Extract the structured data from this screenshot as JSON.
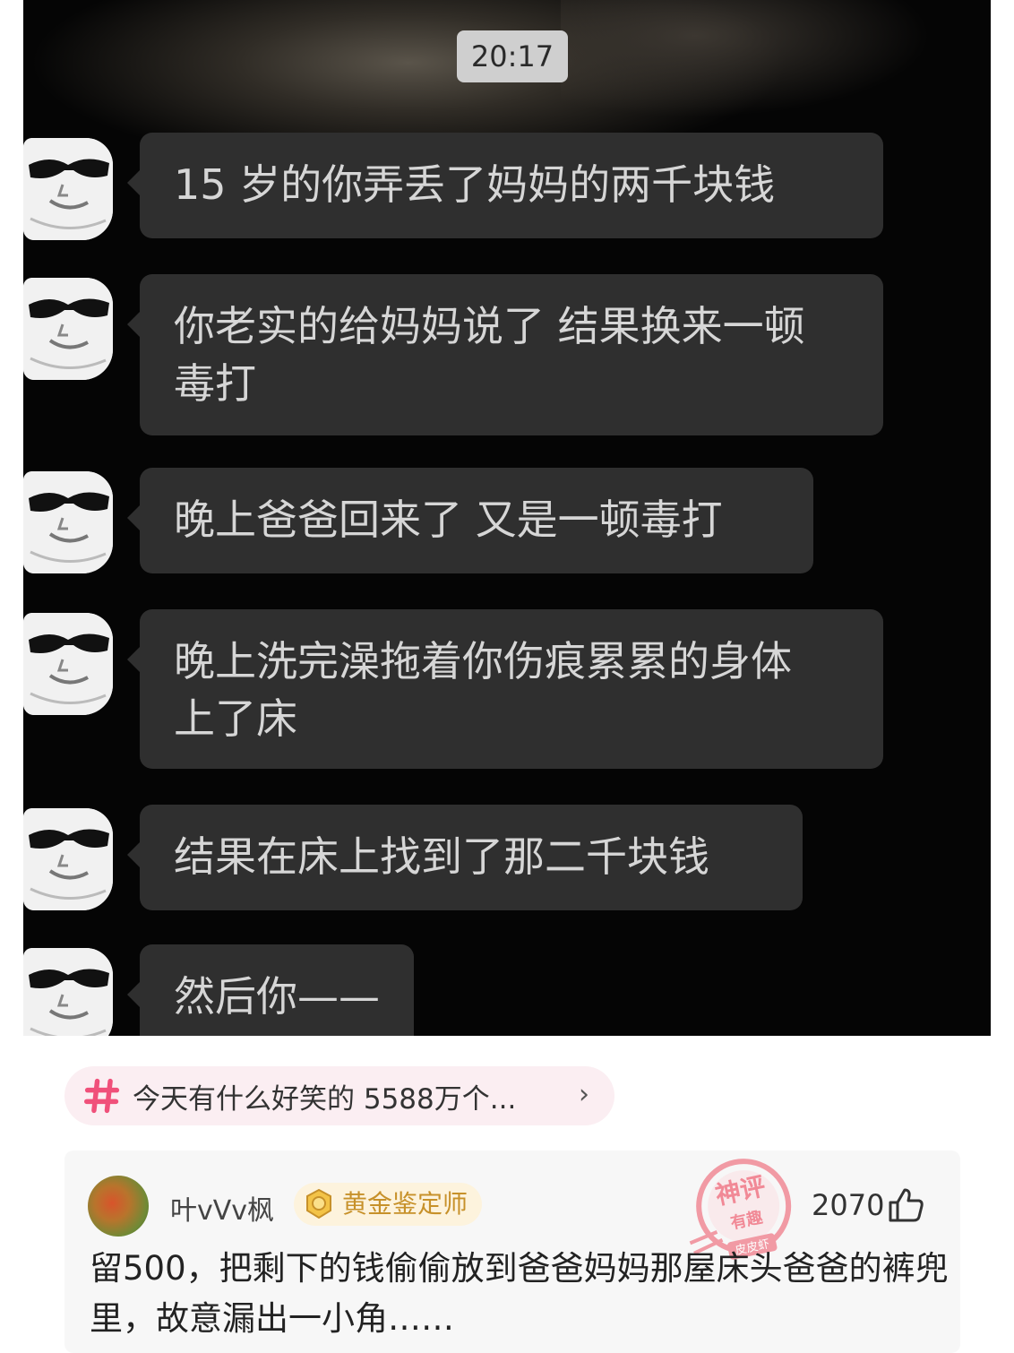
{
  "chat": {
    "time": "20:17",
    "messages": [
      {
        "text": "15 岁的你弄丢了妈妈的两千块钱"
      },
      {
        "text": "你老实的给妈妈说了 结果换来一顿\n毒打"
      },
      {
        "text": "晚上爸爸回来了 又是一顿毒打"
      },
      {
        "text": "晚上洗完澡拖着你伤痕累累的身体\n上了床"
      },
      {
        "text": "结果在床上找到了那二千块钱"
      },
      {
        "text": "然后你——"
      }
    ]
  },
  "topic": {
    "icon": "hashtag-icon",
    "label": "今天有什么好笑的  5588万个...",
    "chevron": "›"
  },
  "comment": {
    "username": "叶vVv枫",
    "badge": "黄金鉴定师",
    "stamp_text": [
      "神评",
      "有趣",
      "皮皮虾"
    ],
    "likes": "2070",
    "text": "留500，把剩下的钱偷偷放到爸爸妈妈那屋床头爸爸的裤兜里，故意漏出一小角……"
  },
  "colors": {
    "chat_background": "#050505",
    "bubble": "#2f2f2f",
    "bubble_text": "#d6d6d6",
    "topic_chip": "#fbeef2",
    "hashtag": "#f0507a",
    "badge_text": "#c7912a",
    "stamp": "#f08a96"
  }
}
